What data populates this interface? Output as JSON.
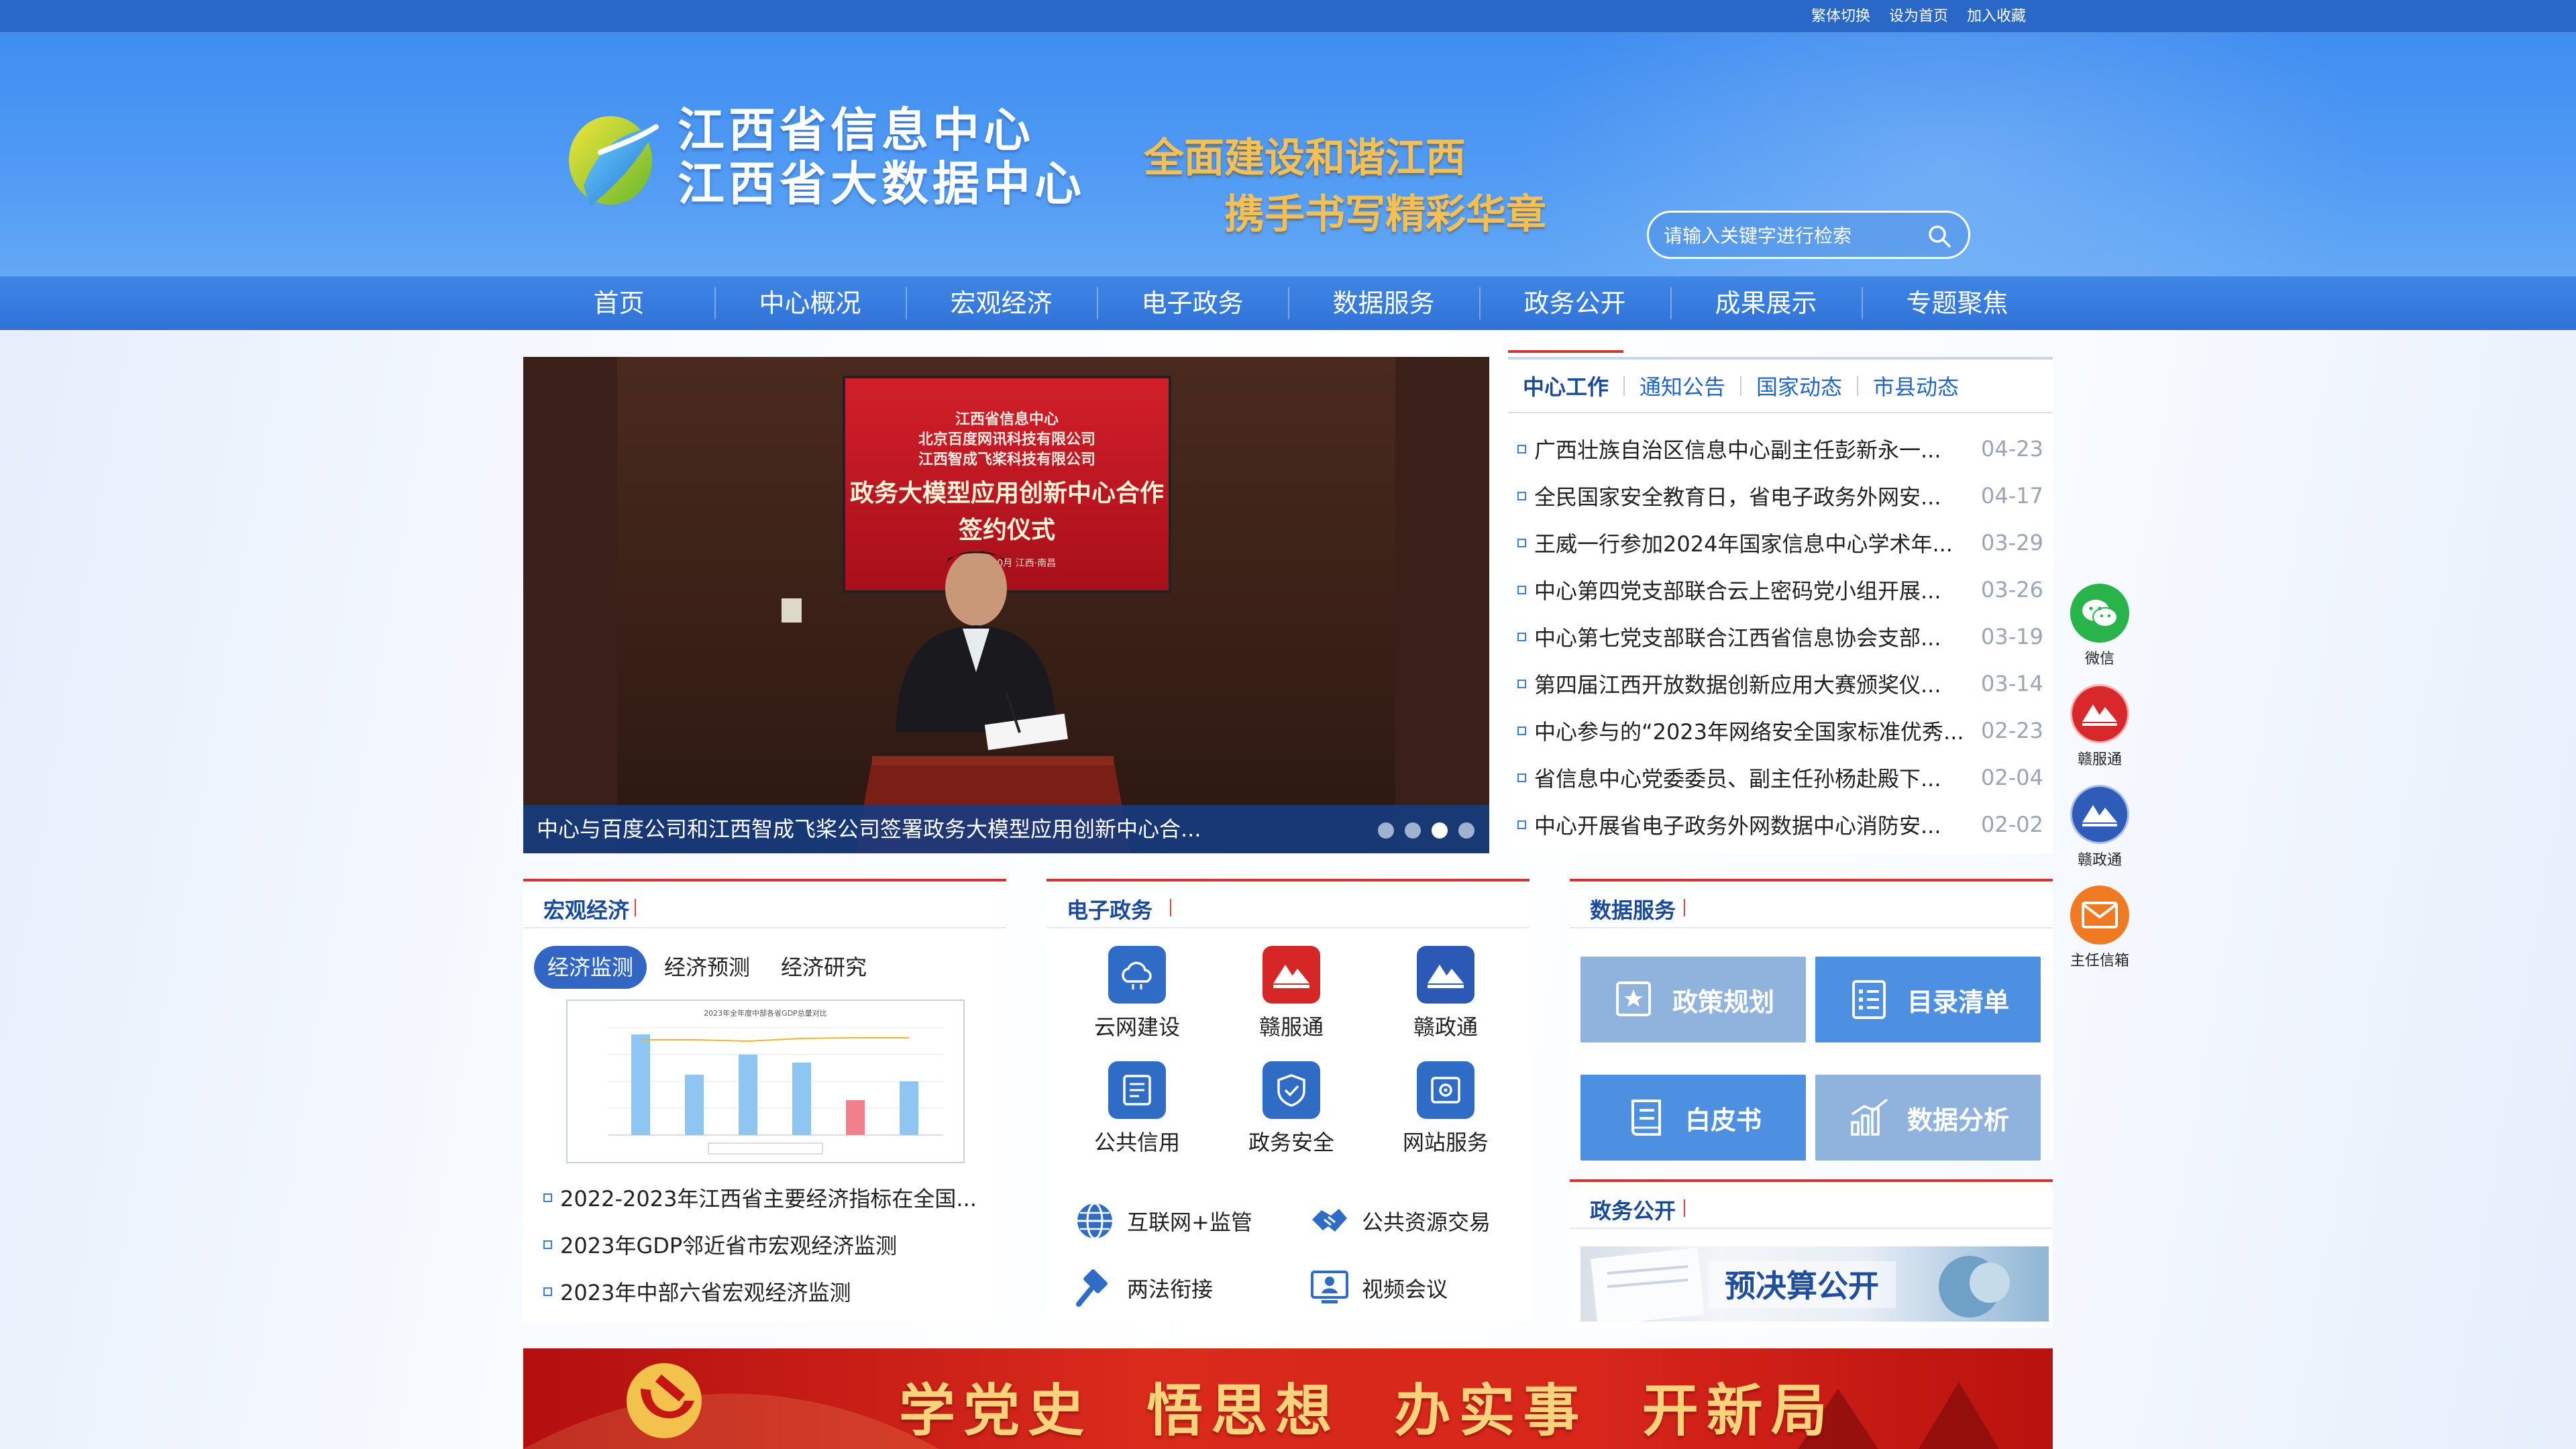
{
  "top_links": [
    "繁体切换",
    "设为首页",
    "加入收藏"
  ],
  "logo": {
    "line1": "江西省信息中心",
    "line2": "江西省大数据中心"
  },
  "slogan": {
    "line1": "全面建设和谐江西",
    "line2": "携手书写精彩华章"
  },
  "search": {
    "placeholder": "请输入关键字进行检索"
  },
  "nav": [
    "首页",
    "中心概况",
    "宏观经济",
    "电子政务",
    "数据服务",
    "政务公开",
    "成果展示",
    "专题聚焦"
  ],
  "carousel": {
    "caption": "中心与百度公司和江西智成飞桨公司签署政务大模型应用创新中心合...",
    "backdrop": {
      "line1": "江西省信息中心",
      "line2": "北京百度网讯科技有限公司",
      "line3": "江西智成飞桨科技有限公司",
      "title1": "政务大模型应用创新中心合作",
      "title2": "签约仪式",
      "date": "2023年10月 江西·南昌"
    },
    "slides": 4,
    "active": 3
  },
  "news": {
    "tabs": [
      "中心工作",
      "通知公告",
      "国家动态",
      "市县动态"
    ],
    "items": [
      {
        "title": "广西壮族自治区信息中心副主任彭新永一...",
        "date": "04-23"
      },
      {
        "title": "全民国家安全教育日，省电子政务外网安...",
        "date": "04-17"
      },
      {
        "title": "王威一行参加2024年国家信息中心学术年...",
        "date": "03-29"
      },
      {
        "title": "中心第四党支部联合云上密码党小组开展...",
        "date": "03-26"
      },
      {
        "title": "中心第七党支部联合江西省信息协会支部...",
        "date": "03-19"
      },
      {
        "title": "第四届江西开放数据创新应用大赛颁奖仪...",
        "date": "03-14"
      },
      {
        "title": "中心参与的“2023年网络安全国家标准优秀...",
        "date": "02-23"
      },
      {
        "title": "省信息中心党委委员、副主任孙杨赴殿下...",
        "date": "02-04"
      },
      {
        "title": "中心开展省电子政务外网数据中心消防安...",
        "date": "02-02"
      }
    ]
  },
  "macro": {
    "title": "宏观经济",
    "subtabs": [
      "经济监测",
      "经济预测",
      "经济研究"
    ],
    "chart_title": "2023年全年度中部各省GDP总量对比",
    "items": [
      "2022-2023年江西省主要经济指标在全国...",
      "2023年GDP邻近省市宏观经济监测",
      "2023年中部六省宏观经济监测"
    ]
  },
  "egov": {
    "title": "电子政务",
    "grid": [
      {
        "label": "云网建设",
        "icon": "cloud-icon"
      },
      {
        "label": "赣服通",
        "icon": "ganfutong-icon"
      },
      {
        "label": "赣政通",
        "icon": "ganzhengtong-icon"
      },
      {
        "label": "公共信用",
        "icon": "credit-icon"
      },
      {
        "label": "政务安全",
        "icon": "shield-icon"
      },
      {
        "label": "网站服务",
        "icon": "website-icon"
      }
    ],
    "rows": [
      {
        "label": "互联网+监管",
        "icon": "globe-icon"
      },
      {
        "label": "公共资源交易",
        "icon": "handshake-icon"
      },
      {
        "label": "两法衔接",
        "icon": "gavel-icon"
      },
      {
        "label": "视频会议",
        "icon": "video-meeting-icon"
      }
    ]
  },
  "data_services": {
    "title": "数据服务",
    "cards": [
      {
        "label": "政策规划",
        "color": "#8fb3dc"
      },
      {
        "label": "目录清单",
        "color": "#4d8fe0"
      },
      {
        "label": "白皮书",
        "color": "#4d8fe0"
      },
      {
        "label": "数据分析",
        "color": "#8fb3dc"
      }
    ]
  },
  "gov_open": {
    "title": "政务公开",
    "banner_text": "预决算公开"
  },
  "floaters": [
    {
      "label": "微信",
      "color": "#29b44b"
    },
    {
      "label": "赣服通",
      "color": "#d8282a"
    },
    {
      "label": "赣政通",
      "color": "#2e5cb8"
    },
    {
      "label": "主任信箱",
      "color": "#f07a22"
    }
  ],
  "red_banner": {
    "text": "学党史 悟思想 办实事 开新局"
  }
}
